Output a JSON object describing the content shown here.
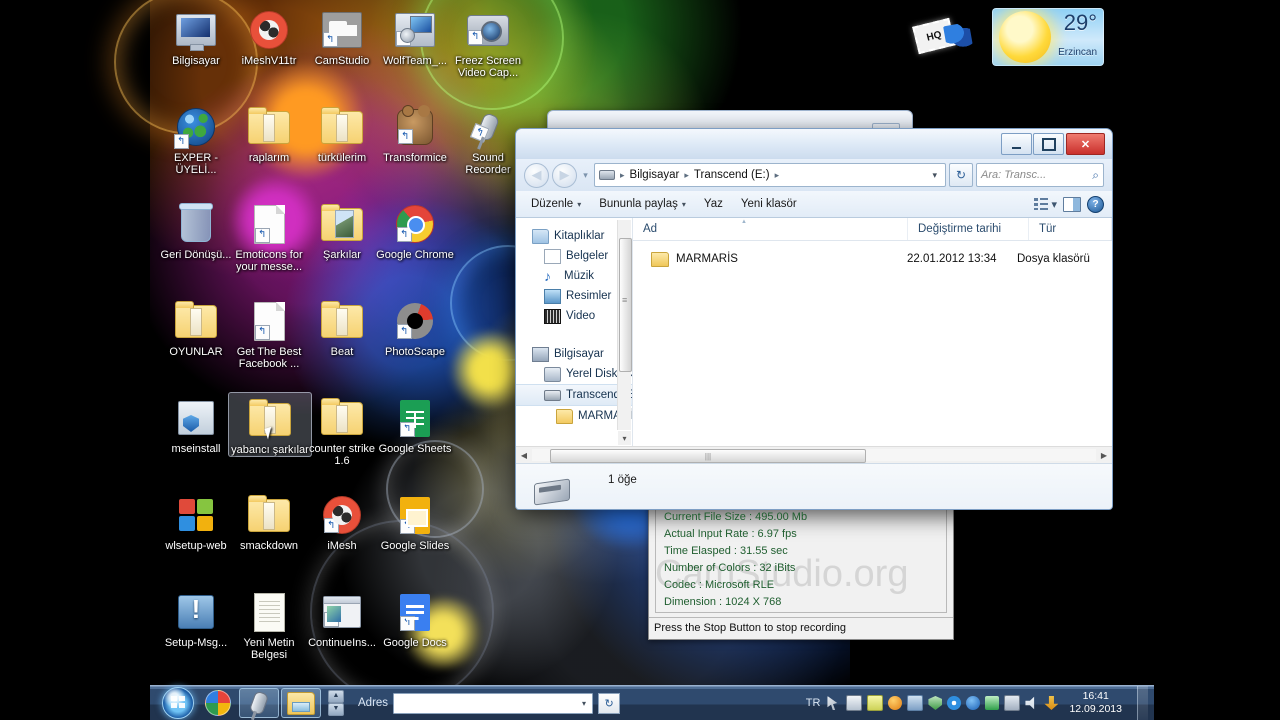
{
  "desktop": {
    "icons": [
      {
        "label": "Bilgisayar",
        "icon": "computer-icon",
        "shortcut": false,
        "selected": false
      },
      {
        "label": "iMeshV11tr",
        "icon": "imesh-icon",
        "shortcut": false,
        "selected": false
      },
      {
        "label": "CamStudio",
        "icon": "camstudio-icon",
        "shortcut": true,
        "selected": false
      },
      {
        "label": "WolfTeam_...",
        "icon": "wolfteam-icon",
        "shortcut": true,
        "selected": false
      },
      {
        "label": "Freez Screen Video Cap...",
        "icon": "camera-icon",
        "shortcut": true,
        "selected": false
      },
      {
        "label": "EXPER - ÜYELİ...",
        "icon": "globe-icon",
        "shortcut": true,
        "selected": false
      },
      {
        "label": "raplarım",
        "icon": "folder-icon",
        "shortcut": false,
        "selected": false
      },
      {
        "label": "türkülerim",
        "icon": "folder-icon",
        "shortcut": false,
        "selected": false
      },
      {
        "label": "Transformice",
        "icon": "transformice-icon",
        "shortcut": true,
        "selected": false
      },
      {
        "label": "Sound Recorder",
        "icon": "microphone-icon",
        "shortcut": true,
        "selected": false
      },
      {
        "label": "Geri Dönüşü...",
        "icon": "recycle-bin-icon",
        "shortcut": false,
        "selected": false
      },
      {
        "label": "Emoticons for your messe...",
        "icon": "document-icon",
        "shortcut": true,
        "selected": false
      },
      {
        "label": "Şarkılar",
        "icon": "folder-picture-icon",
        "shortcut": false,
        "selected": false
      },
      {
        "label": "Google Chrome",
        "icon": "chrome-icon",
        "shortcut": true,
        "selected": false
      },
      {
        "label": "OYUNLAR",
        "icon": "folder-icon",
        "shortcut": false,
        "selected": false
      },
      {
        "label": "Get The Best Facebook ...",
        "icon": "document-icon",
        "shortcut": true,
        "selected": false
      },
      {
        "label": "Beat",
        "icon": "folder-icon",
        "shortcut": false,
        "selected": false
      },
      {
        "label": "PhotoScape",
        "icon": "photoscape-icon",
        "shortcut": true,
        "selected": false
      },
      {
        "label": "mseinstall",
        "icon": "mseinstall-icon",
        "shortcut": false,
        "selected": false
      },
      {
        "label": "yabancı şarkılar",
        "icon": "folder-icon",
        "shortcut": false,
        "selected": true
      },
      {
        "label": "counter strike 1.6",
        "icon": "folder-icon",
        "shortcut": false,
        "selected": false
      },
      {
        "label": "Google Sheets",
        "icon": "google-sheets-icon",
        "shortcut": true,
        "selected": false
      },
      {
        "label": "wlsetup-web",
        "icon": "windows-flag-icon",
        "shortcut": false,
        "selected": false
      },
      {
        "label": "smackdown",
        "icon": "folder-icon",
        "shortcut": false,
        "selected": false
      },
      {
        "label": "iMesh",
        "icon": "imesh-icon",
        "shortcut": true,
        "selected": false
      },
      {
        "label": "Google Slides",
        "icon": "google-slides-icon",
        "shortcut": true,
        "selected": false
      },
      {
        "label": "Setup-Msg...",
        "icon": "setup-package-icon",
        "shortcut": false,
        "selected": false
      },
      {
        "label": "Yeni Metin Belgesi",
        "icon": "notepad-icon",
        "shortcut": false,
        "selected": false
      },
      {
        "label": "ContinueIns...",
        "icon": "window-icon",
        "shortcut": true,
        "selected": false
      },
      {
        "label": "Google Docs",
        "icon": "google-docs-icon",
        "shortcut": true,
        "selected": false
      }
    ]
  },
  "weather_gadget": {
    "temperature": "29°",
    "city": "Erzincan",
    "icon": "sun-icon"
  },
  "explorer": {
    "nav": {
      "back_icon": "back-arrow-icon",
      "forward_icon": "forward-arrow-icon",
      "recent_icon": "recent-pages-chevron-icon",
      "drive_icon": "usb-drive-icon",
      "breadcrumbs": [
        "Bilgisayar",
        "Transcend (E:)"
      ],
      "dropdown_icon": "chevron-down-icon",
      "refresh_icon": "refresh-icon",
      "search_placeholder": "Ara: Transc...",
      "search_icon": "search-icon"
    },
    "window_buttons": {
      "minimize": "minimize-icon",
      "maximize": "maximize-icon",
      "close": "✕"
    },
    "toolbar": {
      "organize": "Düzenle",
      "share_with": "Bununla paylaş",
      "burn": "Yaz",
      "new_folder": "Yeni klasör",
      "views_icon": "view-options-icon",
      "preview_pane_icon": "preview-pane-icon",
      "help_icon": "help-icon",
      "help_glyph": "?"
    },
    "navpane": [
      {
        "label": "Kitaplıklar",
        "icon": "libraries-icon",
        "indent": 0,
        "selected": false
      },
      {
        "label": "Belgeler",
        "icon": "documents-icon",
        "indent": 1,
        "selected": false
      },
      {
        "label": "Müzik",
        "icon": "music-icon",
        "indent": 1,
        "selected": false
      },
      {
        "label": "Resimler",
        "icon": "pictures-icon",
        "indent": 1,
        "selected": false
      },
      {
        "label": "Video",
        "icon": "video-icon",
        "indent": 1,
        "selected": false
      },
      {
        "label": "Bilgisayar",
        "icon": "computer-icon",
        "indent": 0,
        "selected": false
      },
      {
        "label": "Yerel Disk (C:",
        "icon": "hard-disk-icon",
        "indent": 1,
        "selected": false
      },
      {
        "label": "Transcend (E",
        "icon": "usb-drive-icon",
        "indent": 1,
        "selected": true
      },
      {
        "label": "MARMARİS",
        "icon": "folder-icon",
        "indent": 2,
        "selected": false
      }
    ],
    "columns": [
      "Ad",
      "Değiştirme tarihi",
      "Tür"
    ],
    "rows": [
      {
        "name": "MARMARİS",
        "date": "22.01.2012 13:34",
        "type": "Dosya klasörü",
        "icon": "folder-icon"
      }
    ],
    "status": {
      "count_text": "1 öğe",
      "drive_icon": "usb-drive-icon"
    }
  },
  "camstudio": {
    "stats": [
      "Current File Size : 495.00 Mb",
      "Actual Input Rate : 6.97 fps",
      "Time Elasped : 31.55 sec",
      "Number of Colors : 32 iBits",
      "Codec : Microsoft RLE",
      "Dimension : 1024 X 768"
    ],
    "status_text": "Press the Stop Button to stop recording",
    "watermark": "CamStudio.org"
  },
  "taskbar": {
    "start_icon": "windows-start-orb",
    "pinned": [
      {
        "name": "color-wheel-icon",
        "active": false
      },
      {
        "name": "microphone-icon",
        "active": true
      },
      {
        "name": "explorer-folder-icon",
        "active": true
      }
    ],
    "address_toolbar": {
      "label": "Adres",
      "value": "",
      "dropdown_icon": "chevron-down-icon",
      "go_icon": "go-refresh-icon"
    },
    "tray": {
      "language": "TR",
      "icons": [
        "pointer-icon",
        "display-icon",
        "note-icon",
        "orange-icon",
        "update-icon",
        "security-shield-icon",
        "disc-icon",
        "bluetooth-b-icon",
        "network-icon",
        "battery-icon",
        "volume-icon",
        "download-arrow-icon"
      ]
    },
    "clock": {
      "time": "16:41",
      "date": "12.09.2013"
    },
    "show_desktop": "show-desktop-button"
  }
}
